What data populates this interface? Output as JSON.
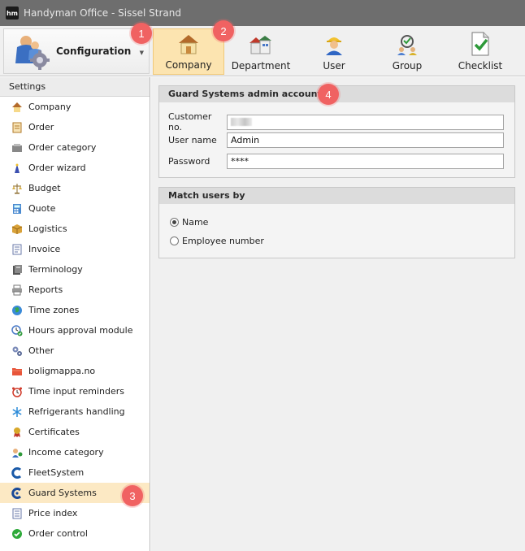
{
  "window": {
    "title": "Handyman Office - Sissel Strand",
    "logo_text": "hm"
  },
  "ribbon": {
    "config_label": "Configuration",
    "tabs": [
      {
        "label": "Company",
        "icon": "house-icon",
        "active": true
      },
      {
        "label": "Department",
        "icon": "buildings-icon",
        "active": false
      },
      {
        "label": "User",
        "icon": "worker-icon",
        "active": false
      },
      {
        "label": "Group",
        "icon": "group-icon",
        "active": false
      },
      {
        "label": "Checklist",
        "icon": "checklist-icon",
        "active": false
      }
    ]
  },
  "badges": [
    "1",
    "2",
    "3",
    "4"
  ],
  "sidebar": {
    "header": "Settings",
    "items": [
      {
        "label": "Company",
        "icon": "house-icon"
      },
      {
        "label": "Order",
        "icon": "order-icon"
      },
      {
        "label": "Order category",
        "icon": "category-icon"
      },
      {
        "label": "Order wizard",
        "icon": "wizard-icon"
      },
      {
        "label": "Budget",
        "icon": "scales-icon"
      },
      {
        "label": "Quote",
        "icon": "calculator-icon"
      },
      {
        "label": "Logistics",
        "icon": "box-icon"
      },
      {
        "label": "Invoice",
        "icon": "invoice-icon"
      },
      {
        "label": "Terminology",
        "icon": "book-icon"
      },
      {
        "label": "Reports",
        "icon": "printer-icon"
      },
      {
        "label": "Time zones",
        "icon": "globe-icon"
      },
      {
        "label": "Hours approval module",
        "icon": "clock-check-icon"
      },
      {
        "label": "Other",
        "icon": "gears-icon"
      },
      {
        "label": "boligmappa.no",
        "icon": "folder-icon"
      },
      {
        "label": "Time input reminders",
        "icon": "alarm-icon"
      },
      {
        "label": "Refrigerants handling",
        "icon": "snowflake-icon"
      },
      {
        "label": "Certificates",
        "icon": "certificate-icon"
      },
      {
        "label": "Income category",
        "icon": "income-icon"
      },
      {
        "label": "FleetSystem",
        "icon": "fleet-icon"
      },
      {
        "label": "Guard Systems",
        "icon": "guard-icon",
        "selected": true
      },
      {
        "label": "Price index",
        "icon": "price-index-icon"
      },
      {
        "label": "Order control",
        "icon": "check-circle-icon"
      }
    ]
  },
  "guard_panel": {
    "title": "Guard Systems admin account",
    "customer_label": "Customer no.",
    "customer_value": "",
    "username_label": "User name",
    "username_value": "Admin",
    "password_label": "Password",
    "password_value": "****"
  },
  "match_panel": {
    "title": "Match users by",
    "options": [
      {
        "label": "Name",
        "checked": true
      },
      {
        "label": "Employee number",
        "checked": false
      }
    ]
  },
  "colors": {
    "selected_bg": "#fce9c4",
    "active_tab_bg": "#fce4b0",
    "badge": "#f06262",
    "titlebar": "#6e6e6e"
  }
}
